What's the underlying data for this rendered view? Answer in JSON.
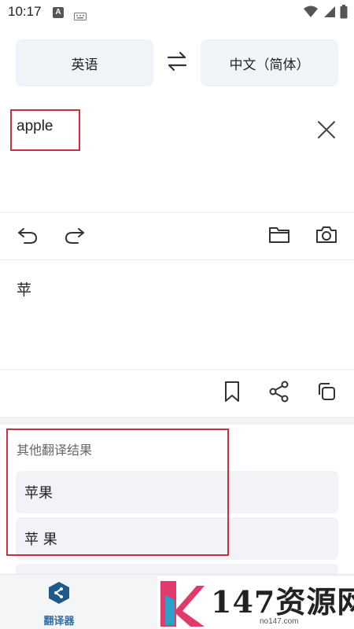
{
  "status_bar": {
    "time": "10:17",
    "notification_letter": "A",
    "icons": [
      "keyboard-icon",
      "wifi-icon",
      "signal-icon",
      "battery-icon"
    ]
  },
  "languages": {
    "source": "英语",
    "target": "中文（简体）",
    "swap_icon": "swap-arrows-icon"
  },
  "input": {
    "text": "apple",
    "clear_icon": "close-icon"
  },
  "toolbar": {
    "icons": [
      "undo-icon",
      "redo-icon",
      "folder-icon",
      "camera-icon"
    ]
  },
  "result": {
    "text": "苹",
    "actions": [
      "bookmark-icon",
      "share-icon",
      "copy-icon"
    ]
  },
  "alternatives": {
    "title": "其他翻译结果",
    "items": [
      "苹果",
      "苹 果",
      ""
    ]
  },
  "bottom_nav": {
    "items": [
      {
        "label": "翻译器",
        "icon": "translator-logo-icon"
      }
    ]
  },
  "watermark": {
    "text": "147资源网",
    "url": "no147.com"
  },
  "colors": {
    "lang_button_bg": "#eef4f8",
    "highlight_border": "#c8323c",
    "alt_item_bg": "#f1f3f6",
    "nav_accent": "#2f6fa5"
  }
}
